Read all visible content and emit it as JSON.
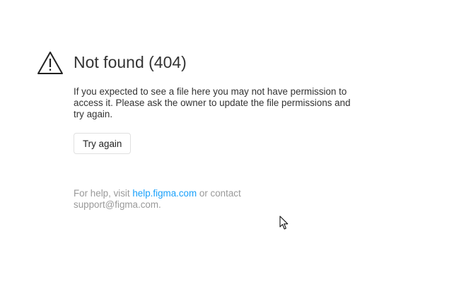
{
  "error": {
    "title": "Not found (404)",
    "message": "If you expected to see a file here you may not have permission to access it. Please ask the owner to update the file permissions and try again.",
    "retry_label": "Try again",
    "icon": "warning-triangle-icon"
  },
  "help": {
    "prefix": "For help, visit ",
    "link_text": "help.figma.com",
    "middle": " or contact",
    "email": "support@figma.com",
    "suffix": ".",
    "link_color": "#18a0fb"
  },
  "cursor": {
    "icon": "mouse-pointer-icon"
  }
}
